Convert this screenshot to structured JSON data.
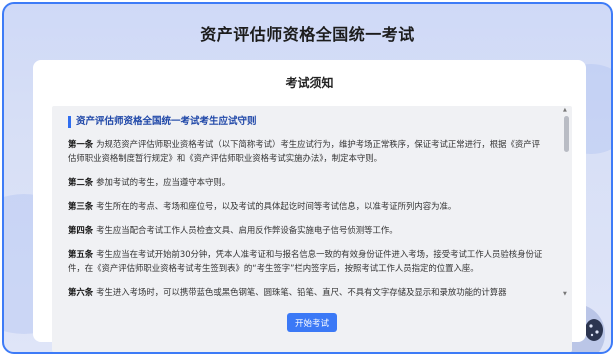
{
  "page": {
    "title": "资产评估师资格全国统一考试"
  },
  "notice": {
    "title": "考试须知",
    "rules_heading": "资产评估师资格全国统一考试考生应试守则",
    "articles": [
      {
        "num": "第一条",
        "text": "为规范资产评估师职业资格考试（以下简称考试）考生应试行为，维护考场正常秩序，保证考试正常进行，根据《资产评估师职业资格制度暂行规定》和《资产评估师职业资格考试实施办法》，制定本守则。"
      },
      {
        "num": "第二条",
        "text": "参加考试的考生，应当遵守本守则。"
      },
      {
        "num": "第三条",
        "text": "考生所在的考点、考场和座位号，以及考试的具体起讫时间等考试信息，以准考证所列内容为准。"
      },
      {
        "num": "第四条",
        "text": "考生应当配合考试工作人员检查文具、启用反作弊设备实施电子信号侦测等工作。"
      },
      {
        "num": "第五条",
        "text": "考生应当在考试开始前30分钟，凭本人准考证和与报名信息一致的有效身份证件进入考场，接受考试工作人员验核身份证件，在《资产评估师职业资格考试考生签到表》的“考生签字”栏内签字后，按照考试工作人员指定的位置入座。"
      },
      {
        "num": "第六条",
        "text": "考生进入考场时，可以携带蓝色或黑色钢笔、圆珠笔、铅笔、直尺、不具有文字存储及显示和录放功能的计算器"
      }
    ]
  },
  "actions": {
    "start_label": "开始考试"
  },
  "colors": {
    "accent": "#3b79f6",
    "frame_border": "#3d7bf7",
    "heading_bar": "#2f6df0"
  }
}
